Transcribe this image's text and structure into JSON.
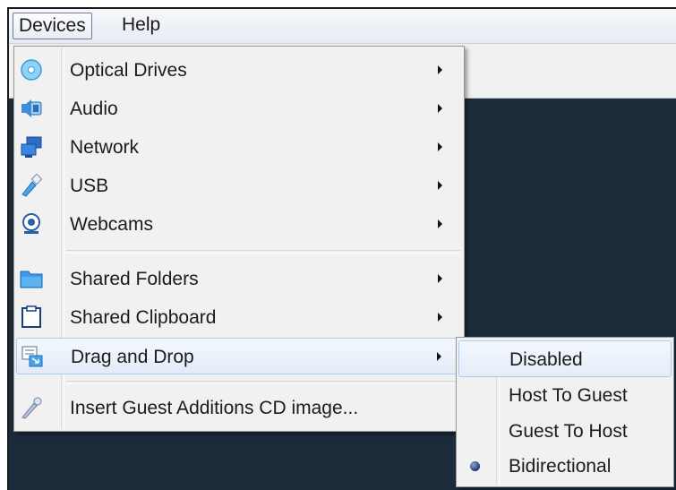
{
  "menubar": {
    "devices": "Devices",
    "help": "Help"
  },
  "devices_menu": {
    "items": [
      {
        "label": "Optical Drives",
        "icon": "optical-disc-icon",
        "has_submenu": true
      },
      {
        "label": "Audio",
        "icon": "audio-icon",
        "has_submenu": true
      },
      {
        "label": "Network",
        "icon": "network-icon",
        "has_submenu": true
      },
      {
        "label": "USB",
        "icon": "usb-icon",
        "has_submenu": true
      },
      {
        "label": "Webcams",
        "icon": "webcam-icon",
        "has_submenu": true
      },
      {
        "label": "Shared Folders",
        "icon": "folder-icon",
        "has_submenu": true
      },
      {
        "label": "Shared Clipboard",
        "icon": "clipboard-icon",
        "has_submenu": true
      },
      {
        "label": "Drag and Drop",
        "icon": "drag-drop-icon",
        "has_submenu": true,
        "highlighted": true
      },
      {
        "label": "Insert Guest Additions CD image...",
        "icon": "cd-insert-icon",
        "has_submenu": false
      }
    ]
  },
  "drag_drop_submenu": {
    "items": [
      {
        "label": "Disabled",
        "highlighted": true,
        "selected": false
      },
      {
        "label": "Host To Guest",
        "selected": false
      },
      {
        "label": "Guest To Host",
        "selected": false
      },
      {
        "label": "Bidirectional",
        "selected": true
      }
    ]
  },
  "colors": {
    "vm_background": "#1b2b3a",
    "menu_background": "#f1f1f1",
    "highlight_border": "#aecbef"
  }
}
